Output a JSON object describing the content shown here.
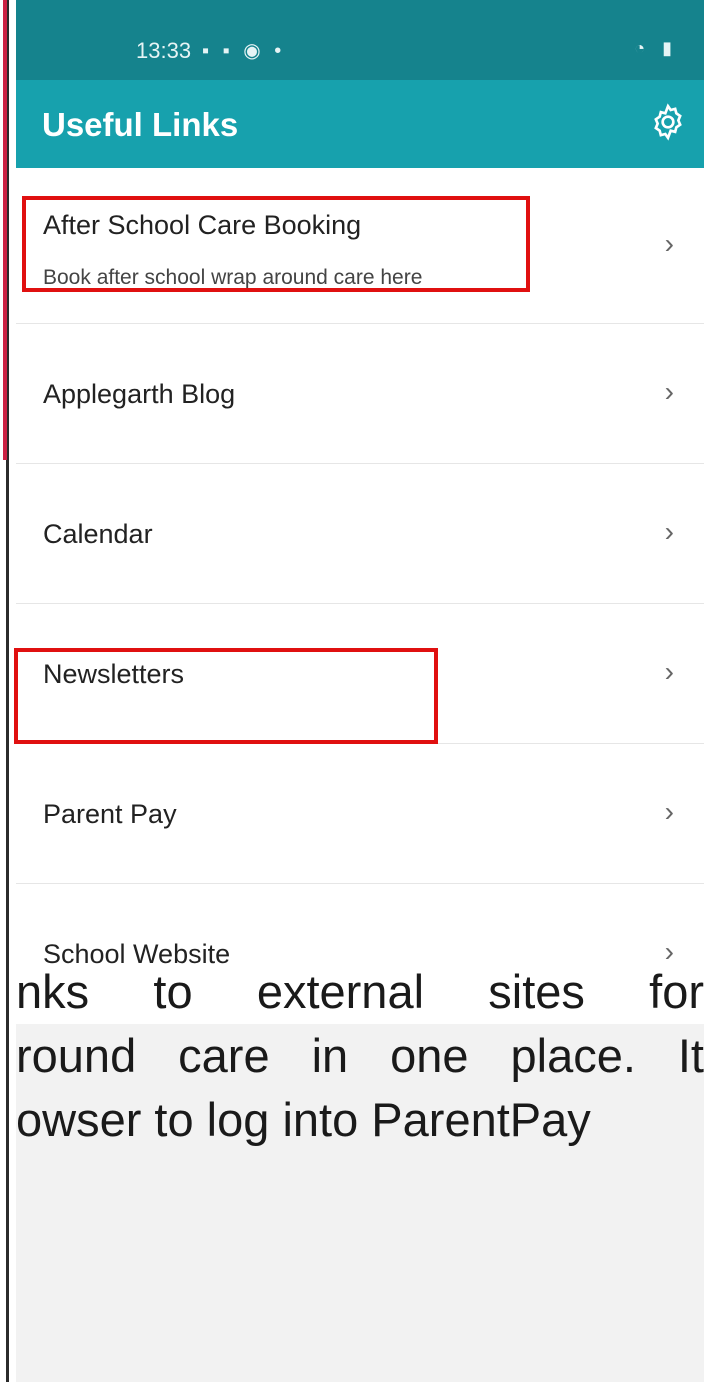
{
  "status_bar": {
    "time": "13:33",
    "notification_icons": "▪ ▪ ◉ •",
    "system_icons": "◔ ▮"
  },
  "app_bar": {
    "title": "Useful Links"
  },
  "links": [
    {
      "title": "After School Care Booking",
      "subtitle": "Book after school wrap around care here"
    },
    {
      "title": "Applegarth Blog"
    },
    {
      "title": "Calendar"
    },
    {
      "title": "Newsletters"
    },
    {
      "title": "Parent Pay"
    },
    {
      "title": "School Website"
    }
  ],
  "chevron": "›",
  "document_text": [
    "nks to external sites for",
    "round care in one place. It",
    "owser to log into ParentPay"
  ],
  "colors": {
    "statusbar": "#15838d",
    "appbar": "#17a1ad",
    "highlight": "#e01010"
  }
}
